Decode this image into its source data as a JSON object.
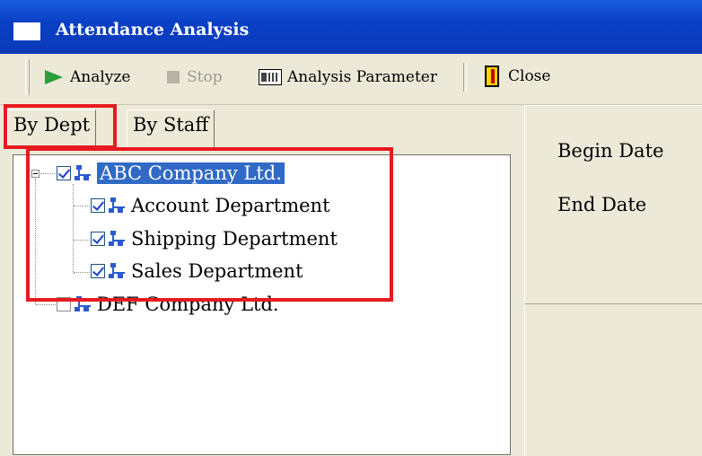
{
  "window": {
    "title": "Attendance Analysis",
    "icon": "window-icon"
  },
  "toolbar": {
    "analyze_label": "Analyze",
    "stop_label": "Stop",
    "analysis_parameter_label": "Analysis Parameter",
    "close_label": "Close"
  },
  "tabs": [
    {
      "label": "By Dept",
      "active": true
    },
    {
      "label": "By Staff",
      "active": false
    }
  ],
  "tree": {
    "root": {
      "label": "ABC Company Ltd.",
      "checked": true,
      "selected": true,
      "expanded": true
    },
    "children": [
      {
        "label": "Account Department",
        "checked": true
      },
      {
        "label": "Shipping Department",
        "checked": true
      },
      {
        "label": "Sales Department",
        "checked": true
      }
    ],
    "root2": {
      "label": "DEF Company Ltd.",
      "checked": false
    }
  },
  "params": {
    "begin_date_label": "Begin Date",
    "end_date_label": "End Date"
  },
  "colors": {
    "highlight": "#e8191f",
    "selection": "#316ac5",
    "titlebar": "#0a3fc6"
  }
}
